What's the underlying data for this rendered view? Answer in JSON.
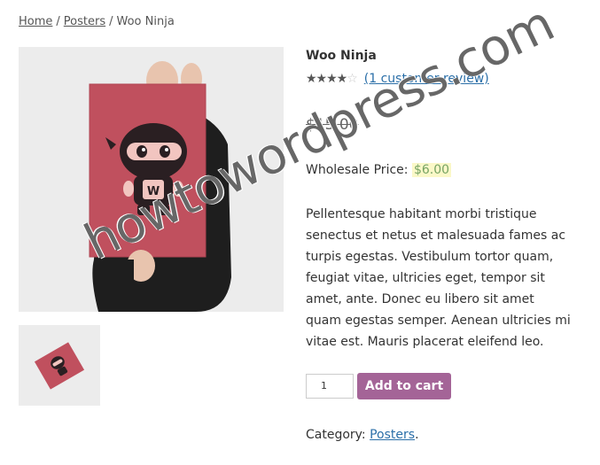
{
  "breadcrumb": {
    "home": "Home",
    "category": "Posters",
    "current": "Woo Ninja",
    "separator": "/"
  },
  "product": {
    "title": "Woo Ninja",
    "rating": {
      "stars": "★★★★",
      "stars_off": "☆",
      "value": 4,
      "max": 5,
      "review_link": "(1 customer review)"
    },
    "old_price": "$15.00",
    "wholesale_label": "Wholesale Price:",
    "wholesale_price": "$6.00",
    "description": "Pellentesque habitant morbi tristique senectus et netus et malesuada fames ac turpis egestas. Vestibulum tortor quam, feugiat vitae, ultricies eget, tempor sit amet, ante. Donec eu libero sit amet quam egestas semper. Aenean ultricies mi vitae est. Mauris placerat eleifend leo.",
    "quantity": "1",
    "add_to_cart": "Add to cart",
    "category_label": "Category:",
    "category": "Posters",
    "category_end": ".",
    "poster_letter": "W"
  },
  "watermark": "howtowordpress.com",
  "colors": {
    "button": "#a46497",
    "link": "#2b6fa8",
    "poster": "#c0505e",
    "price_highlight": "#fbf8c8"
  }
}
